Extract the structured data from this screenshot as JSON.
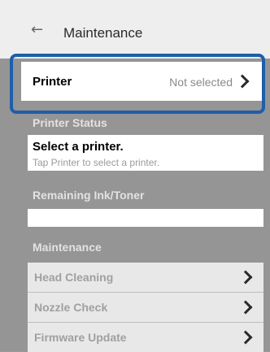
{
  "header": {
    "back_icon": "left-arrow-icon",
    "title": "Maintenance"
  },
  "printer_row": {
    "label": "Printer",
    "value": "Not selected"
  },
  "printer_status": {
    "section_label": "Printer Status",
    "main_text": "Select a printer.",
    "sub_text": "Tap Printer to select a printer."
  },
  "ink": {
    "section_label": "Remaining Ink/Toner"
  },
  "maintenance": {
    "section_label": "Maintenance",
    "items": [
      {
        "label": "Head Cleaning"
      },
      {
        "label": "Nozzle Check"
      },
      {
        "label": "Firmware Update"
      }
    ]
  },
  "colors": {
    "highlight": "#1e5eaa",
    "overlay_gray": "#959595"
  }
}
